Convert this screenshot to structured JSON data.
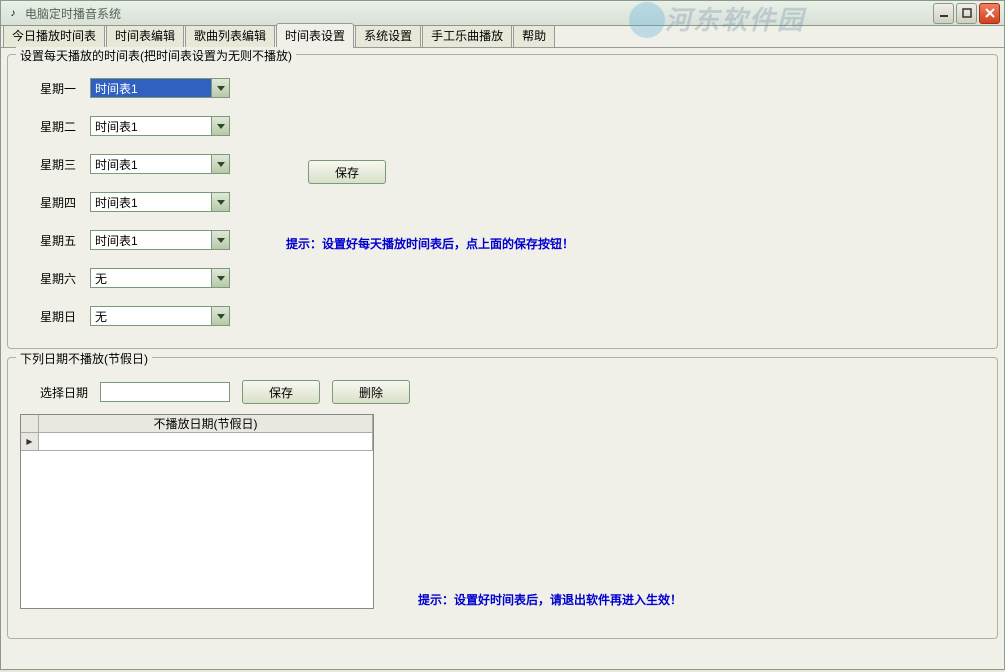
{
  "window": {
    "title": "电脑定时播音系统"
  },
  "watermark": "河东软件园",
  "tabs": {
    "items": [
      {
        "label": "今日播放时间表",
        "active": false
      },
      {
        "label": "时间表编辑",
        "active": false
      },
      {
        "label": "歌曲列表编辑",
        "active": false
      },
      {
        "label": "时间表设置",
        "active": true
      },
      {
        "label": "系统设置",
        "active": false
      },
      {
        "label": "手工乐曲播放",
        "active": false
      },
      {
        "label": "帮助",
        "active": false
      }
    ]
  },
  "group1": {
    "title": "设置每天播放的时间表(把时间表设置为无则不播放)",
    "days": [
      {
        "label": "星期一",
        "value": "时间表1",
        "selected": true
      },
      {
        "label": "星期二",
        "value": "时间表1",
        "selected": false
      },
      {
        "label": "星期三",
        "value": "时间表1",
        "selected": false
      },
      {
        "label": "星期四",
        "value": "时间表1",
        "selected": false
      },
      {
        "label": "星期五",
        "value": "时间表1",
        "selected": false
      },
      {
        "label": "星期六",
        "value": "无",
        "selected": false
      },
      {
        "label": "星期日",
        "value": "无",
        "selected": false
      }
    ],
    "save_label": "保存",
    "hint": "提示：设置好每天播放时间表后，点上面的保存按钮！"
  },
  "group2": {
    "title": "下列日期不播放(节假日)",
    "date_label": "选择日期",
    "date_value": "",
    "save_label": "保存",
    "delete_label": "删除",
    "column_header": "不播放日期(节假日)",
    "hint": "提示：设置好时间表后，请退出软件再进入生效！"
  }
}
